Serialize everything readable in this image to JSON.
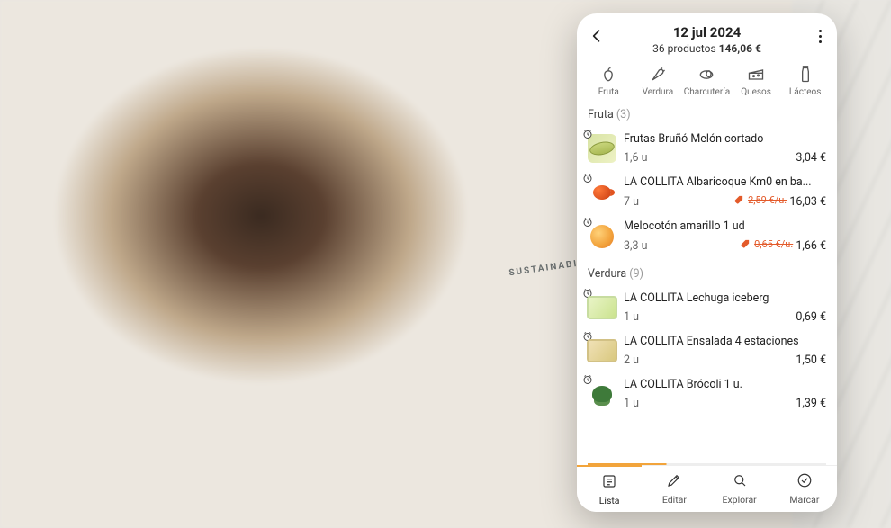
{
  "header": {
    "title": "12 jul 2024",
    "subtitle_count": "36 productos",
    "subtitle_total": "146,06 €"
  },
  "categories": [
    {
      "id": "fruta",
      "label": "Fruta"
    },
    {
      "id": "verdura",
      "label": "Verdura"
    },
    {
      "id": "charcuteria",
      "label": "Charcutería"
    },
    {
      "id": "quesos",
      "label": "Quesos"
    },
    {
      "id": "lacteos",
      "label": "Lácteos"
    }
  ],
  "sections": [
    {
      "id": "fruta",
      "label": "Fruta",
      "count": "3",
      "items": [
        {
          "title": "Frutas Bruñó Melón cortado",
          "qty": "1,6 u",
          "price": "3,04 €",
          "discount": null,
          "thumb": "melon"
        },
        {
          "title": "LA COLLITA Albaricoque Km0 en ba...",
          "qty": "7 u",
          "price": "16,03 €",
          "discount": "2,59 €/u.",
          "thumb": "apricot"
        },
        {
          "title": "Melocotón amarillo 1 ud",
          "qty": "3,3 u",
          "price": "1,66 €",
          "discount": "0,65 €/u.",
          "thumb": "peach"
        }
      ]
    },
    {
      "id": "verdura",
      "label": "Verdura",
      "count": "9",
      "items": [
        {
          "title": "LA COLLITA Lechuga iceberg",
          "qty": "1 u",
          "price": "0,69 €",
          "discount": null,
          "thumb": "lettuce"
        },
        {
          "title": "LA COLLITA Ensalada 4 estaciones",
          "qty": "2 u",
          "price": "1,50 €",
          "discount": null,
          "thumb": "salad"
        },
        {
          "title": "LA COLLITA Brócoli 1 u.",
          "qty": "1 u",
          "price": "1,39 €",
          "discount": null,
          "thumb": "broccoli"
        }
      ]
    }
  ],
  "bottom_tabs": [
    {
      "id": "lista",
      "label": "Lista",
      "icon": "list",
      "active": true
    },
    {
      "id": "editar",
      "label": "Editar",
      "icon": "pencil",
      "active": false
    },
    {
      "id": "explorar",
      "label": "Explorar",
      "icon": "search",
      "active": false
    },
    {
      "id": "marcar",
      "label": "Marcar",
      "icon": "check",
      "active": false
    }
  ]
}
